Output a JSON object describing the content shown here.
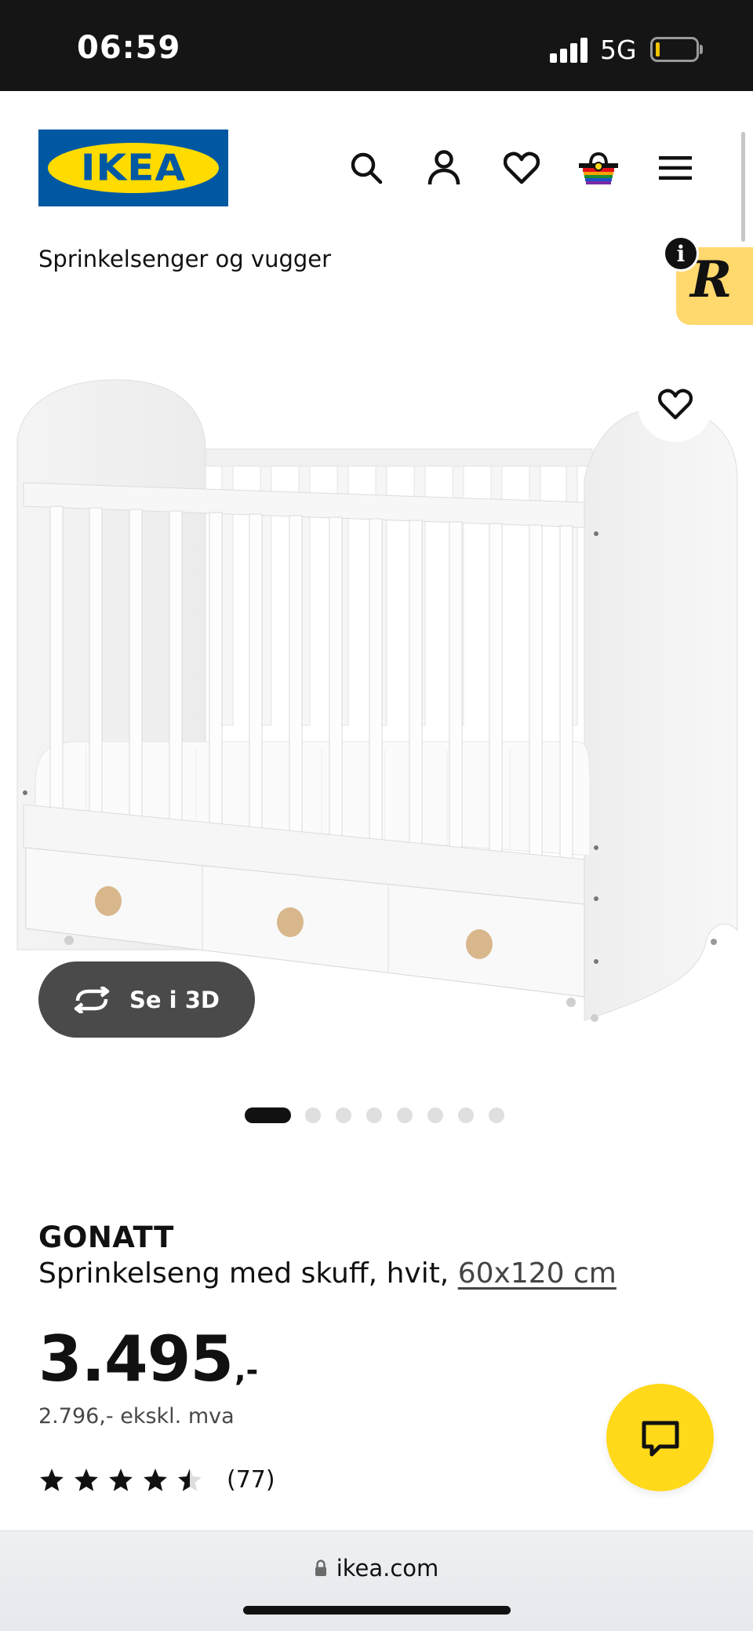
{
  "status_bar": {
    "time": "06:59",
    "network": "5G",
    "battery_level": 0.1,
    "battery_color": "#f2c200"
  },
  "header": {
    "logo_text": "IKEA",
    "brand_colors": {
      "blue": "#0058a3",
      "yellow": "#ffdb00"
    },
    "icons": [
      "search-icon",
      "account-icon",
      "heart-icon",
      "basket-icon",
      "menu-icon"
    ]
  },
  "breadcrumb": "Sprinkelsenger og vugger",
  "badge": {
    "letter": "R",
    "info": "i",
    "color": "#ffd86e"
  },
  "gallery": {
    "view_3d_label": "Se i 3D",
    "image_count": 8,
    "active_index": 0
  },
  "product": {
    "name": "GONATT",
    "description": "Sprinkelseng med skuff, hvit, ",
    "size_link": "60x120 cm",
    "price": "3.495",
    "price_suffix": ",-",
    "price_excl_vat": "2.796,- ekskl. mva",
    "rating": 4.5,
    "review_count": "(77)"
  },
  "browser": {
    "url": "ikea.com"
  }
}
